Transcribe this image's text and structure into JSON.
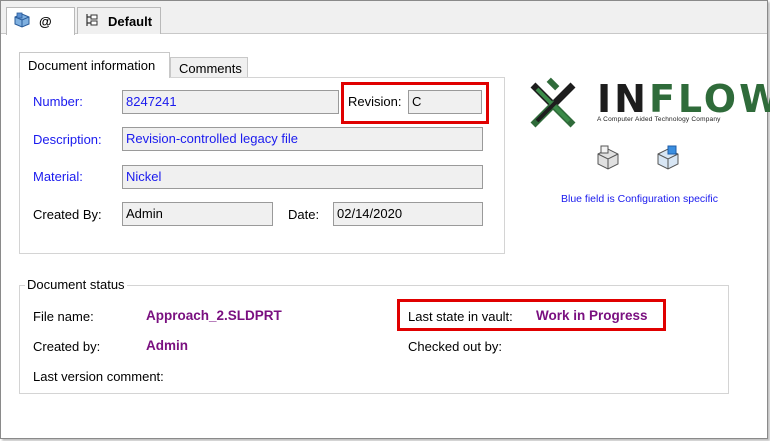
{
  "top_tabs": [
    {
      "label": "@"
    },
    {
      "label": "Default"
    }
  ],
  "doc_tabs": [
    {
      "label": "Document information"
    },
    {
      "label": "Comments"
    }
  ],
  "document_info": {
    "number_label": "Number:",
    "number_value": "8247241",
    "revision_label": "Revision:",
    "revision_value": "C",
    "description_label": "Description:",
    "description_value": "Revision-controlled legacy file",
    "material_label": "Material:",
    "material_value": "Nickel",
    "created_by_label": "Created By:",
    "created_by_value": "Admin",
    "date_label": "Date:",
    "date_value": "02/14/2020"
  },
  "logo": {
    "text_a": "IN",
    "text_b": "FLOW",
    "tagline": "A Computer Aided Technology Company"
  },
  "config_note": "Blue field is Configuration specific",
  "document_status": {
    "title": "Document status",
    "file_name_label": "File name:",
    "file_name_value": "Approach_2.SLDPRT",
    "created_by_label": "Created by:",
    "created_by_value": "Admin",
    "last_version_comment_label": "Last version comment:",
    "last_state_label": "Last state in vault:",
    "last_state_value": "Work in Progress",
    "checked_out_by_label": "Checked out by:"
  },
  "colors": {
    "config_specific_label": "#1a1aee",
    "status_value": "#7a1080",
    "highlight": "#e00000",
    "brand_green": "#2f6b3a"
  }
}
